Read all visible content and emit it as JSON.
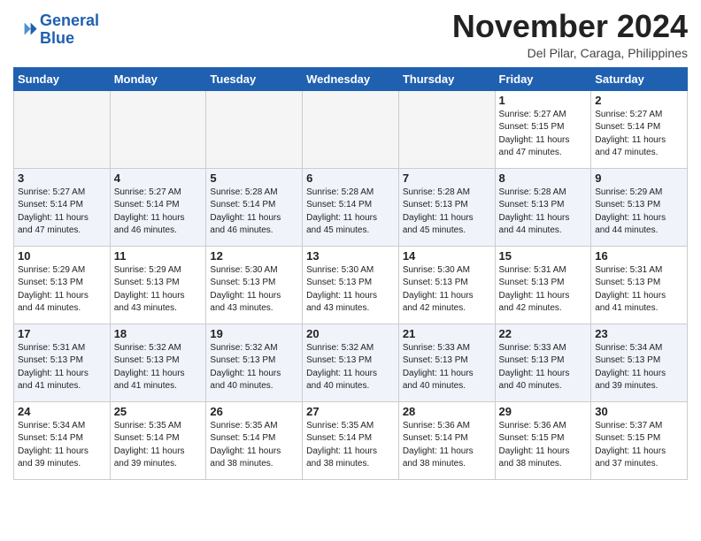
{
  "logo": {
    "line1": "General",
    "line2": "Blue"
  },
  "title": "November 2024",
  "location": "Del Pilar, Caraga, Philippines",
  "days_header": [
    "Sunday",
    "Monday",
    "Tuesday",
    "Wednesday",
    "Thursday",
    "Friday",
    "Saturday"
  ],
  "weeks": [
    [
      {
        "num": "",
        "info": ""
      },
      {
        "num": "",
        "info": ""
      },
      {
        "num": "",
        "info": ""
      },
      {
        "num": "",
        "info": ""
      },
      {
        "num": "",
        "info": ""
      },
      {
        "num": "1",
        "info": "Sunrise: 5:27 AM\nSunset: 5:15 PM\nDaylight: 11 hours\nand 47 minutes."
      },
      {
        "num": "2",
        "info": "Sunrise: 5:27 AM\nSunset: 5:14 PM\nDaylight: 11 hours\nand 47 minutes."
      }
    ],
    [
      {
        "num": "3",
        "info": "Sunrise: 5:27 AM\nSunset: 5:14 PM\nDaylight: 11 hours\nand 47 minutes."
      },
      {
        "num": "4",
        "info": "Sunrise: 5:27 AM\nSunset: 5:14 PM\nDaylight: 11 hours\nand 46 minutes."
      },
      {
        "num": "5",
        "info": "Sunrise: 5:28 AM\nSunset: 5:14 PM\nDaylight: 11 hours\nand 46 minutes."
      },
      {
        "num": "6",
        "info": "Sunrise: 5:28 AM\nSunset: 5:14 PM\nDaylight: 11 hours\nand 45 minutes."
      },
      {
        "num": "7",
        "info": "Sunrise: 5:28 AM\nSunset: 5:13 PM\nDaylight: 11 hours\nand 45 minutes."
      },
      {
        "num": "8",
        "info": "Sunrise: 5:28 AM\nSunset: 5:13 PM\nDaylight: 11 hours\nand 44 minutes."
      },
      {
        "num": "9",
        "info": "Sunrise: 5:29 AM\nSunset: 5:13 PM\nDaylight: 11 hours\nand 44 minutes."
      }
    ],
    [
      {
        "num": "10",
        "info": "Sunrise: 5:29 AM\nSunset: 5:13 PM\nDaylight: 11 hours\nand 44 minutes."
      },
      {
        "num": "11",
        "info": "Sunrise: 5:29 AM\nSunset: 5:13 PM\nDaylight: 11 hours\nand 43 minutes."
      },
      {
        "num": "12",
        "info": "Sunrise: 5:30 AM\nSunset: 5:13 PM\nDaylight: 11 hours\nand 43 minutes."
      },
      {
        "num": "13",
        "info": "Sunrise: 5:30 AM\nSunset: 5:13 PM\nDaylight: 11 hours\nand 43 minutes."
      },
      {
        "num": "14",
        "info": "Sunrise: 5:30 AM\nSunset: 5:13 PM\nDaylight: 11 hours\nand 42 minutes."
      },
      {
        "num": "15",
        "info": "Sunrise: 5:31 AM\nSunset: 5:13 PM\nDaylight: 11 hours\nand 42 minutes."
      },
      {
        "num": "16",
        "info": "Sunrise: 5:31 AM\nSunset: 5:13 PM\nDaylight: 11 hours\nand 41 minutes."
      }
    ],
    [
      {
        "num": "17",
        "info": "Sunrise: 5:31 AM\nSunset: 5:13 PM\nDaylight: 11 hours\nand 41 minutes."
      },
      {
        "num": "18",
        "info": "Sunrise: 5:32 AM\nSunset: 5:13 PM\nDaylight: 11 hours\nand 41 minutes."
      },
      {
        "num": "19",
        "info": "Sunrise: 5:32 AM\nSunset: 5:13 PM\nDaylight: 11 hours\nand 40 minutes."
      },
      {
        "num": "20",
        "info": "Sunrise: 5:32 AM\nSunset: 5:13 PM\nDaylight: 11 hours\nand 40 minutes."
      },
      {
        "num": "21",
        "info": "Sunrise: 5:33 AM\nSunset: 5:13 PM\nDaylight: 11 hours\nand 40 minutes."
      },
      {
        "num": "22",
        "info": "Sunrise: 5:33 AM\nSunset: 5:13 PM\nDaylight: 11 hours\nand 40 minutes."
      },
      {
        "num": "23",
        "info": "Sunrise: 5:34 AM\nSunset: 5:13 PM\nDaylight: 11 hours\nand 39 minutes."
      }
    ],
    [
      {
        "num": "24",
        "info": "Sunrise: 5:34 AM\nSunset: 5:14 PM\nDaylight: 11 hours\nand 39 minutes."
      },
      {
        "num": "25",
        "info": "Sunrise: 5:35 AM\nSunset: 5:14 PM\nDaylight: 11 hours\nand 39 minutes."
      },
      {
        "num": "26",
        "info": "Sunrise: 5:35 AM\nSunset: 5:14 PM\nDaylight: 11 hours\nand 38 minutes."
      },
      {
        "num": "27",
        "info": "Sunrise: 5:35 AM\nSunset: 5:14 PM\nDaylight: 11 hours\nand 38 minutes."
      },
      {
        "num": "28",
        "info": "Sunrise: 5:36 AM\nSunset: 5:14 PM\nDaylight: 11 hours\nand 38 minutes."
      },
      {
        "num": "29",
        "info": "Sunrise: 5:36 AM\nSunset: 5:15 PM\nDaylight: 11 hours\nand 38 minutes."
      },
      {
        "num": "30",
        "info": "Sunrise: 5:37 AM\nSunset: 5:15 PM\nDaylight: 11 hours\nand 37 minutes."
      }
    ]
  ]
}
